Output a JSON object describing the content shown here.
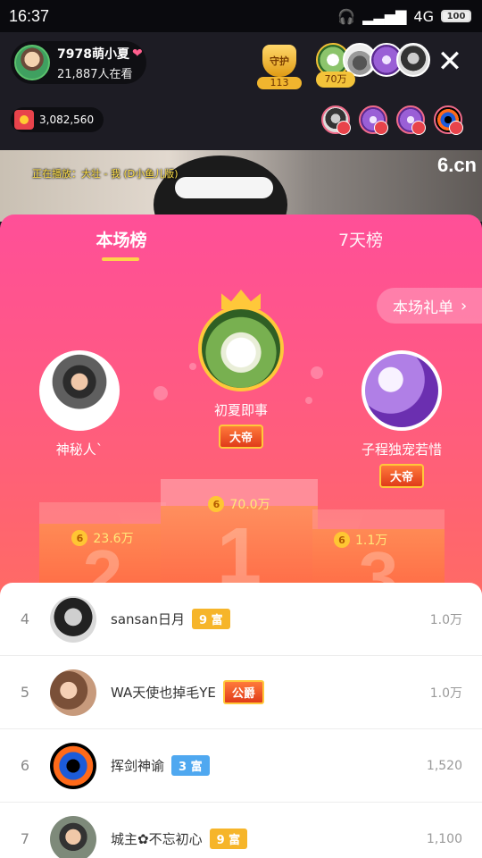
{
  "status_bar": {
    "time": "16:37",
    "network": "4G",
    "battery": "100"
  },
  "host": {
    "name": "7978萌小夏",
    "viewers": "21,887人在看"
  },
  "guard": {
    "label": "守护",
    "count": "113"
  },
  "top_contributor": {
    "amount": "70万"
  },
  "coins": {
    "value": "3,082,560"
  },
  "video": {
    "now_playing": "正在播放：大壮 - 我 (D小鱼儿版)",
    "watermark": "6.cn"
  },
  "tabs": [
    "本场榜",
    "7天榜"
  ],
  "gift_list_button": "本场礼单",
  "podium": [
    {
      "rank": "1",
      "name": "初夏即事",
      "title": "大帝",
      "score": "70.0万"
    },
    {
      "rank": "2",
      "name": "神秘人`",
      "score": "23.6万"
    },
    {
      "rank": "3",
      "name": "子程独宠若惜",
      "title": "大帝",
      "score": "1.1万"
    }
  ],
  "ranking": [
    {
      "rank": "4",
      "name": "sansan日月",
      "badge": "9 富",
      "score": "1.0万"
    },
    {
      "rank": "5",
      "name": "WA天使也掉毛YE",
      "badge": "公爵",
      "score": "1.0万"
    },
    {
      "rank": "6",
      "name": "挥剑神谕",
      "badge": "3 富",
      "score": "1,520"
    },
    {
      "rank": "7",
      "name": "城主✿不忘初心",
      "badge": "9 富",
      "score": "1,100"
    }
  ],
  "colors": {
    "accent": "#ff4f98",
    "gold": "#ffc83a",
    "coin": "#ffc633"
  }
}
